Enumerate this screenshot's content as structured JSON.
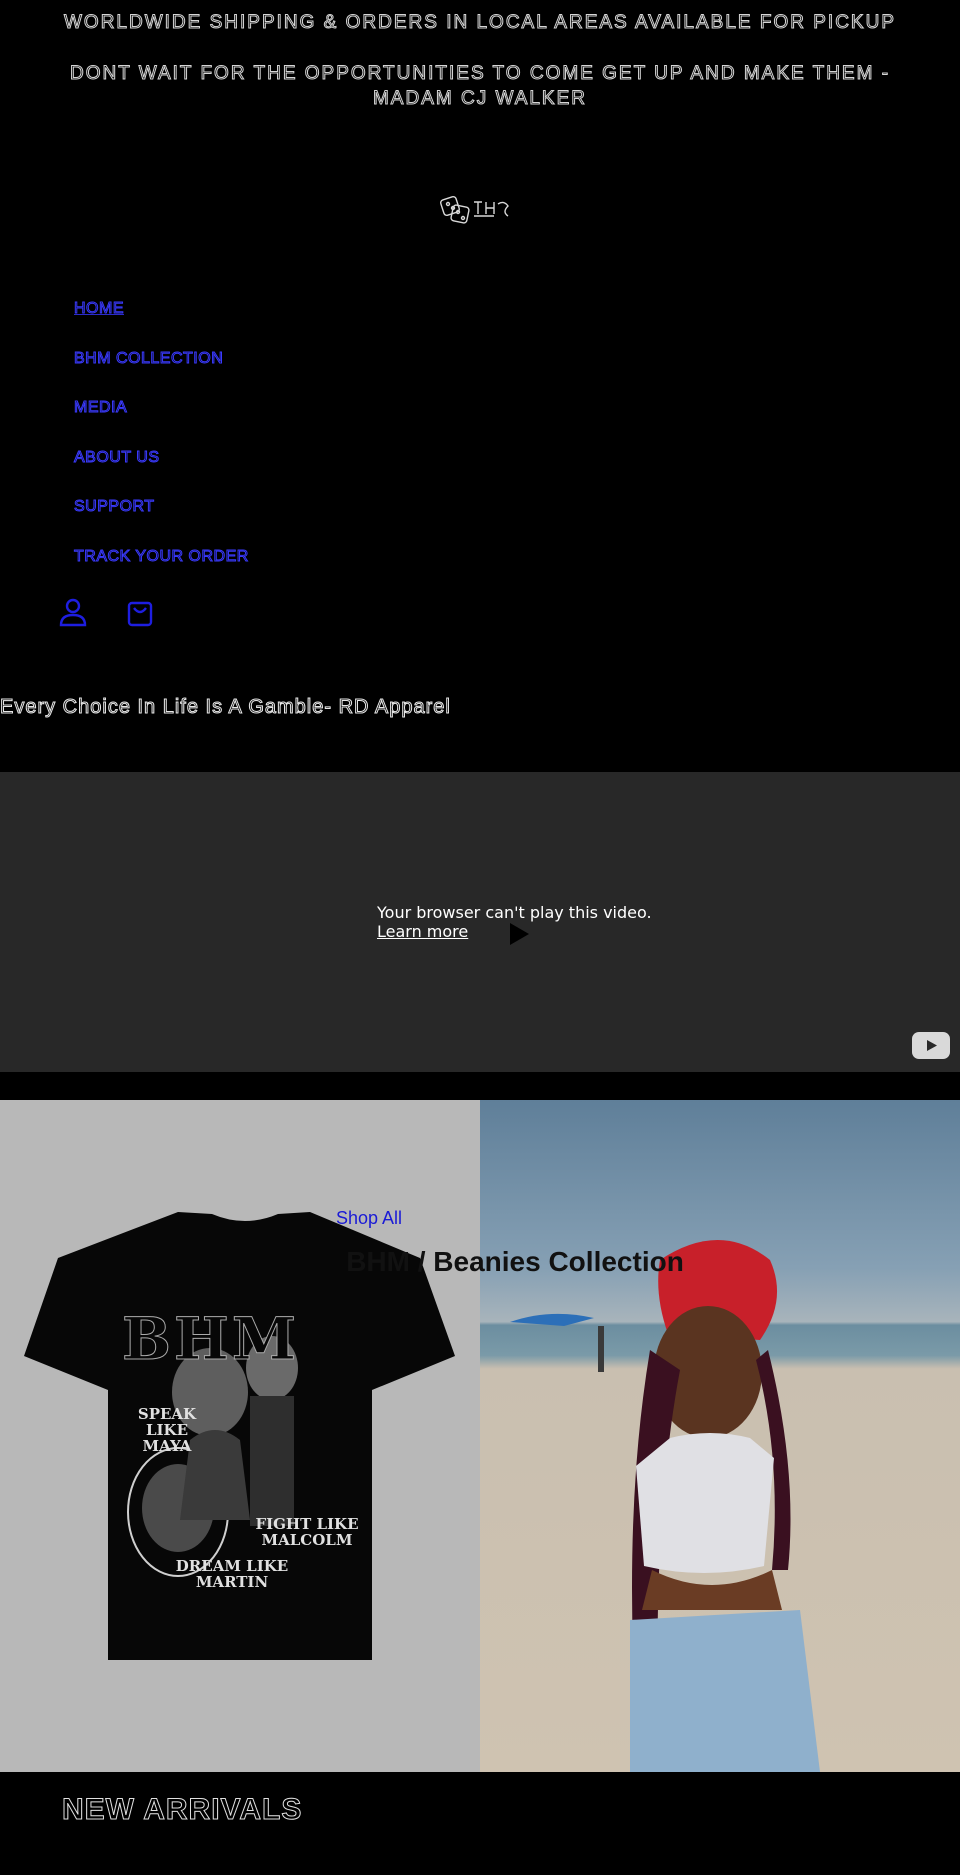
{
  "announcement": {
    "primary": "WORLDWIDE SHIPPING & ORDERS IN LOCAL AREAS AVAILABLE FOR PICKUP",
    "quote": "DONT WAIT FOR THE OPPORTUNITIES TO COME GET UP AND MAKE THEM -MADAM CJ WALKER"
  },
  "header": {
    "logo_icon": "dice-logo-icon",
    "nav": [
      {
        "label": "HOME",
        "underlined": true
      },
      {
        "label": "BHM COLLECTION",
        "underlined": false
      },
      {
        "label": "MEDIA",
        "underlined": false
      },
      {
        "label": "ABOUT US",
        "underlined": false
      },
      {
        "label": "SUPPORT",
        "underlined": false
      },
      {
        "label": "TRACK YOUR ORDER",
        "underlined": false
      }
    ],
    "icons": {
      "account": "account-icon",
      "cart": "cart-icon"
    }
  },
  "tagline": "Every Choice In Life Is A Gamble- RD Apparel",
  "video": {
    "message": "Your browser can't play this video.",
    "link": "Learn more",
    "icons": {
      "play": "play-icon",
      "youtube": "youtube-icon"
    }
  },
  "collection": {
    "shop_all": "Shop All",
    "title": "BHM / Beanies Collection",
    "shirt": {
      "heading": "BHM",
      "line1": "SPEAK LIKE",
      "line1b": "MAYA",
      "line2": "FIGHT LIKE",
      "line2b": "MALCOLM",
      "line3": "DREAM LIKE",
      "line3b": "MARTIN"
    }
  },
  "new_arrivals": "NEW ARRIVALS",
  "colors": {
    "background": "#000000",
    "nav_link": "#3a3aff",
    "shop_all": "#1a1ad6",
    "video_bg": "#282828",
    "left_panel": "#b8b8b8"
  }
}
